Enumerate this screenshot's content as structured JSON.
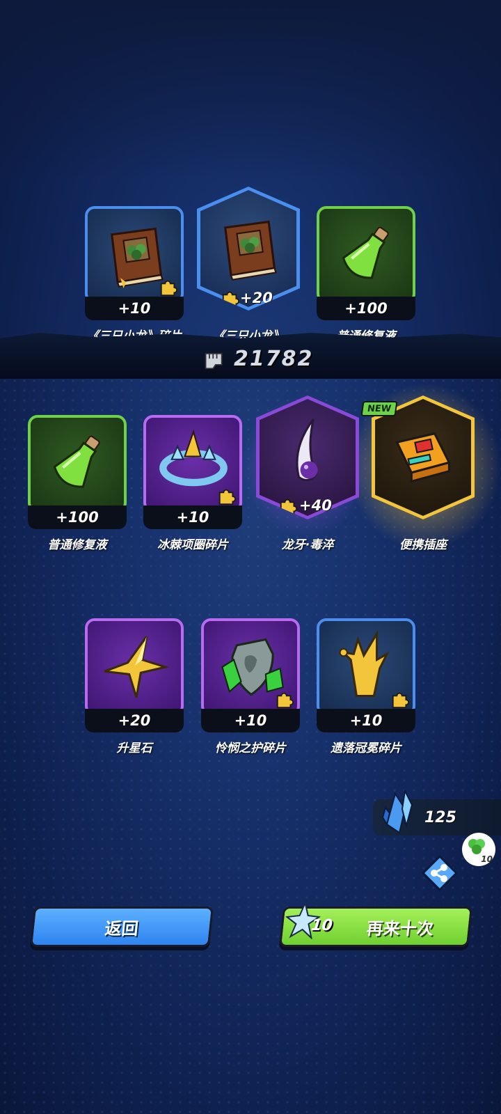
{
  "score": {
    "value": "21782",
    "icon": "fist-icon"
  },
  "rows": [
    {
      "items": [
        {
          "count": "+10",
          "name": "《三只小龙》碎片",
          "icon": "book-icon",
          "frame": "blue-card",
          "fragment": true
        },
        {
          "count": "+20",
          "name": "《三只小龙》",
          "icon": "book-icon",
          "frame": "blue-hex",
          "fragment": true
        },
        {
          "count": "+100",
          "name": "普通修复液",
          "icon": "potion-icon",
          "frame": "green-card",
          "fragment": false
        }
      ]
    },
    {
      "items": [
        {
          "count": "+100",
          "name": "普通修复液",
          "icon": "potion-icon",
          "frame": "green-card",
          "fragment": false
        },
        {
          "count": "+10",
          "name": "冰棘项圈碎片",
          "icon": "collar-icon",
          "frame": "purple-card",
          "fragment": true
        },
        {
          "count": "+40",
          "name": "龙牙·毒淬",
          "icon": "fang-icon",
          "frame": "purple-hex",
          "fragment": true
        },
        {
          "count": "",
          "name": "便携插座",
          "icon": "socket-icon",
          "frame": "gold-hex",
          "fragment": false,
          "badge": "NEW"
        }
      ]
    },
    {
      "items": [
        {
          "count": "+20",
          "name": "升星石",
          "icon": "star-stone-icon",
          "frame": "purple-card",
          "fragment": false
        },
        {
          "count": "+10",
          "name": "怜悯之护碎片",
          "icon": "shield-icon",
          "frame": "purple-card",
          "fragment": true
        },
        {
          "count": "+10",
          "name": "遗落冠冕碎片",
          "icon": "crown-icon",
          "frame": "blue-card",
          "fragment": true
        }
      ]
    }
  ],
  "currency": {
    "value": "125",
    "icon": "crystal-icon"
  },
  "share": {
    "icon": "share-icon",
    "bubble_count": "10"
  },
  "buttons": {
    "back": "返回",
    "again": "再来十次",
    "again_cost": "10"
  },
  "colors": {
    "green_button": "#8ee048",
    "blue_button": "#3f95f5",
    "gold_glow": "#f3c53a",
    "purple_frame": "#b86af0"
  }
}
